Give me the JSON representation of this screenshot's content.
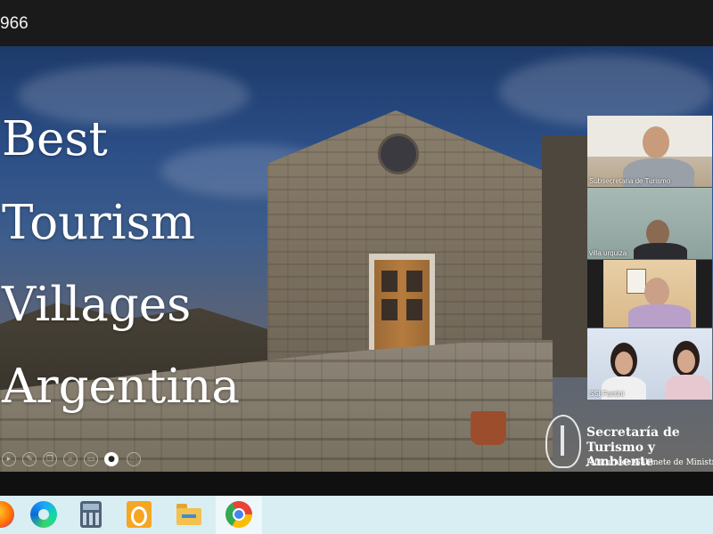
{
  "meeting": {
    "id_fragment": "966"
  },
  "slide": {
    "title_lines": [
      "Best",
      "Tourism",
      "Villages",
      "Argentina"
    ],
    "logo": {
      "line1": "Secretaría de",
      "line2": "Turismo y Ambiente",
      "line3": "Jefatura de Gabinete de Ministros"
    }
  },
  "presentation_toolbar": {
    "icons": [
      "play-icon",
      "pen-icon",
      "copy-icon",
      "zoom-icon",
      "screen-icon",
      "camera-icon",
      "more-icon"
    ]
  },
  "participants": [
    {
      "name": "Subsecretaria de Turismo"
    },
    {
      "name": "villa urquiza"
    },
    {
      "name": ""
    },
    {
      "name": "SSI Fantini"
    }
  ],
  "taskbar": {
    "apps": [
      "firefox-icon",
      "edge-icon",
      "calculator-icon",
      "outlook-icon",
      "file-explorer-icon",
      "chrome-icon"
    ],
    "active_app": "chrome-icon"
  }
}
